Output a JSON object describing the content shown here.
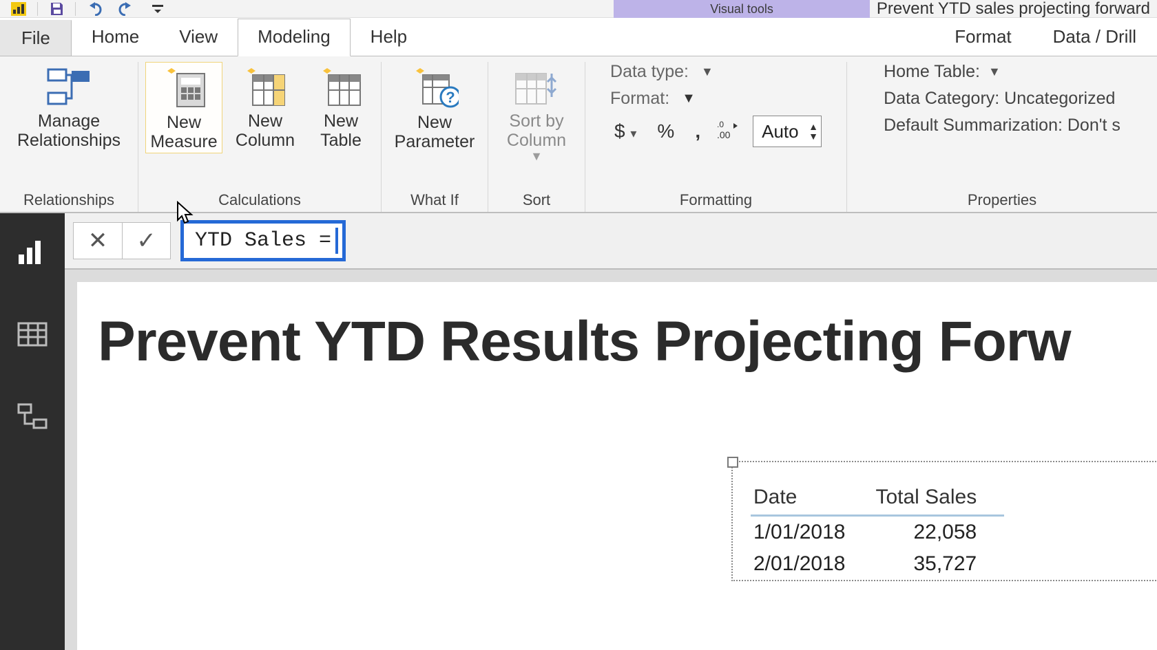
{
  "titlebar": {
    "visual_tools_label": "Visual tools",
    "document_title": "Prevent YTD sales projecting forward"
  },
  "qat_icons": [
    "logo-icon",
    "save-icon",
    "undo-icon",
    "redo-icon",
    "customize-icon"
  ],
  "tabs": {
    "file": "File",
    "home": "Home",
    "view": "View",
    "modeling": "Modeling",
    "help": "Help",
    "format": "Format",
    "data_drill": "Data / Drill",
    "active": "modeling"
  },
  "ribbon": {
    "relationships": {
      "manage_1": "Manage",
      "manage_2": "Relationships",
      "group": "Relationships"
    },
    "calculations": {
      "new_measure_1": "New",
      "new_measure_2": "Measure",
      "new_column_1": "New",
      "new_column_2": "Column",
      "new_table_1": "New",
      "new_table_2": "Table",
      "group": "Calculations"
    },
    "whatif": {
      "new_parameter_1": "New",
      "new_parameter_2": "Parameter",
      "group": "What If"
    },
    "sort": {
      "sort_by_1": "Sort by",
      "sort_by_2": "Column",
      "group": "Sort"
    },
    "formatting": {
      "data_type": "Data type:",
      "format": "Format:",
      "currency": "$",
      "percent": "%",
      "comma": ",",
      "decimals": ".00",
      "auto": "Auto",
      "group": "Formatting"
    },
    "properties": {
      "home_table": "Home Table:",
      "data_category": "Data Category: Uncategorized",
      "default_sum": "Default Summarization: Don't s",
      "group": "Properties"
    }
  },
  "formula_bar": {
    "cancel": "✕",
    "accept": "✓",
    "formula_text": "YTD Sales = "
  },
  "nav": [
    "report-view",
    "data-view",
    "model-view"
  ],
  "canvas": {
    "title": "Prevent YTD Results Projecting Forw"
  },
  "table_visual": {
    "columns": [
      "Date",
      "Total Sales"
    ],
    "rows": [
      [
        "1/01/2018",
        "22,058"
      ],
      [
        "2/01/2018",
        "35,727"
      ]
    ]
  }
}
